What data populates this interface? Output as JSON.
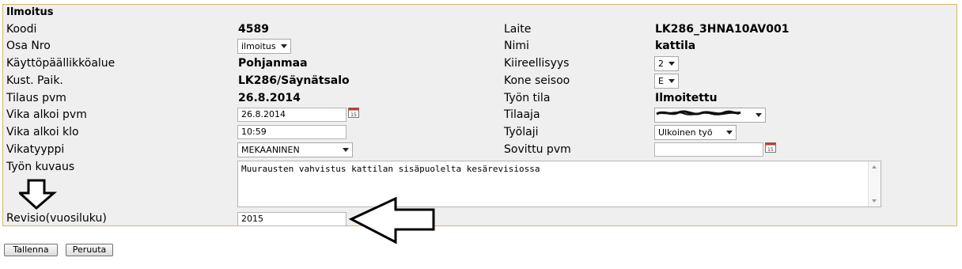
{
  "form": {
    "section_title": "Ilmoitus",
    "left_rows": [
      {
        "label": "Koodi",
        "value": "4589"
      },
      {
        "label": "Osa Nro",
        "select": "ilmoitus"
      },
      {
        "label": "Käyttöpäällikköalue",
        "value": "Pohjanmaa"
      },
      {
        "label": "Kust. Paik.",
        "value": "LK286/Säynätsalo"
      },
      {
        "label": "Tilaus pvm",
        "value": "26.8.2014"
      },
      {
        "label": "Vika alkoi pvm",
        "input": "26.8.2014",
        "icon": "calendar-icon"
      },
      {
        "label": "Vika alkoi klo",
        "input": "10:59"
      },
      {
        "label": "Vikatyyppi",
        "select": "MEKAANINEN"
      },
      {
        "label": "Työn kuvaus",
        "textarea": "Muurausten vahvistus kattilan sisäpuolelta kesärevisiossa"
      },
      {
        "label": "Revisio(vuosiluku)",
        "input": "2015"
      }
    ],
    "right_rows": [
      {
        "label": "Laite",
        "value": "LK286_3HNA10AV001"
      },
      {
        "label": "Nimi",
        "value": "kattila"
      },
      {
        "label": "Kiireellisyys",
        "select": "2"
      },
      {
        "label": "Kone seisoo",
        "select": "E"
      },
      {
        "label": "Työn tila",
        "value": "Ilmoitettu"
      },
      {
        "label": "Tilaaja",
        "select": "",
        "note": "redacted"
      },
      {
        "label": "Työlaji",
        "select": "Ulkoinen työ"
      },
      {
        "label": "Sovittu pvm",
        "input": "",
        "icon": "calendar-icon"
      }
    ]
  },
  "buttons": {
    "save": "Tallenna",
    "cancel": "Peruuta"
  },
  "annotations": [
    "down-arrow-icon",
    "left-arrow-icon"
  ],
  "colors": {
    "panel_bg": "#efefef",
    "panel_border": "#d6b56a"
  }
}
